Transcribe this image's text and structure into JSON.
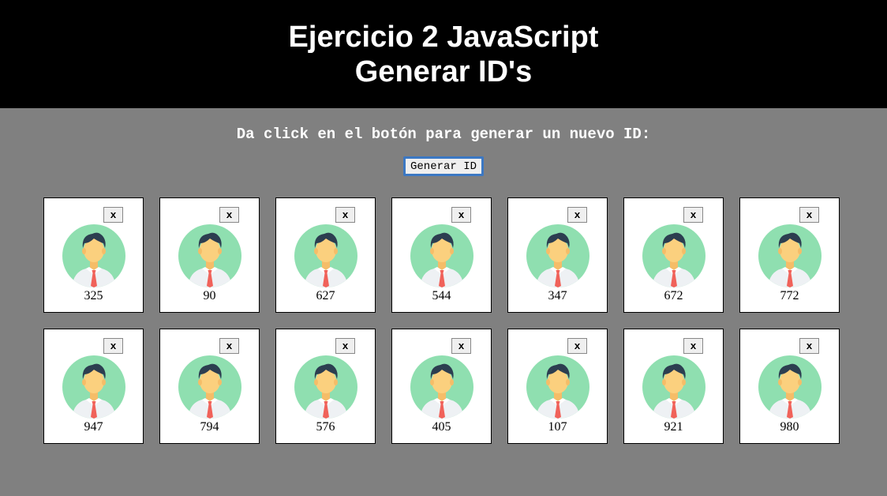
{
  "header": {
    "title_line1": "Ejercicio 2 JavaScript",
    "title_line2": "Generar ID's"
  },
  "instructions": "Da click en el botón para generar un nuevo ID:",
  "generate_button": "Generar ID",
  "close_label": "x",
  "cards": [
    {
      "id": "325"
    },
    {
      "id": "90"
    },
    {
      "id": "627"
    },
    {
      "id": "544"
    },
    {
      "id": "347"
    },
    {
      "id": "672"
    },
    {
      "id": "772"
    },
    {
      "id": "947"
    },
    {
      "id": "794"
    },
    {
      "id": "576"
    },
    {
      "id": "405"
    },
    {
      "id": "107"
    },
    {
      "id": "921"
    },
    {
      "id": "980"
    }
  ],
  "avatar_icon": "person-avatar-icon",
  "colors": {
    "header_bg": "#000000",
    "page_bg": "#808080",
    "avatar_circle": "#8fdfb0",
    "tie": "#f0625a",
    "hair": "#2c3e50",
    "skin": "#fbd07e"
  }
}
